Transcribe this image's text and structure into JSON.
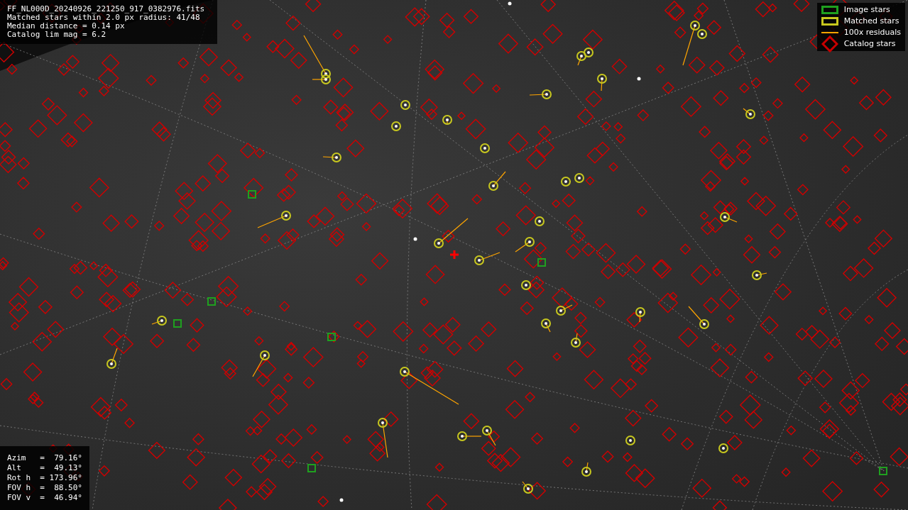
{
  "info_panel": {
    "lines": [
      "FF_NL000D_20240926_221250_917_0382976.fits",
      "Matched stars within 2.0 px radius: 41/48",
      "Median distance = 0.14 px",
      "Catalog lim mag = 6.2"
    ]
  },
  "legend": {
    "items": [
      {
        "kind": "box",
        "color": "#1fa01f",
        "label": "Image stars"
      },
      {
        "kind": "box",
        "color": "#c8c81e",
        "label": "Matched stars"
      },
      {
        "kind": "line",
        "color": "#ffa500",
        "label": "100x residuals"
      },
      {
        "kind": "diamond",
        "color": "#c80000",
        "label": "Catalog stars"
      }
    ]
  },
  "pointing_panel": {
    "lines": [
      "Azim   =  79.16°",
      "Alt    =  49.13°",
      "Rot h  = 173.96°",
      "FOV h  =  88.50°",
      "FOV v  =  46.94°"
    ]
  }
}
